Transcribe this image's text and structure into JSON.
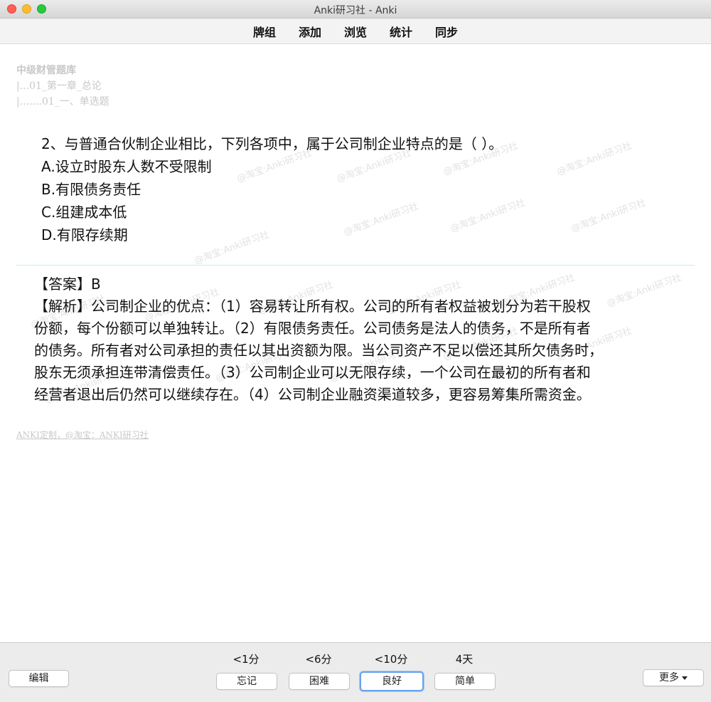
{
  "window": {
    "title": "Anki研习社 - Anki"
  },
  "toolbar": {
    "items": [
      "牌组",
      "添加",
      "浏览",
      "统计",
      "同步"
    ]
  },
  "card": {
    "breadcrumb": {
      "deck": "中级财管题库",
      "chapter": "|...01_第一章_总论",
      "section": "|.......01_一、单选题"
    },
    "question": {
      "stem": "2、与普通合伙制企业相比，下列各项中，属于公司制企业特点的是（     ）。",
      "options": [
        "A.设立时股东人数不受限制",
        "B.有限债务责任",
        "C.组建成本低",
        "D.有限存续期"
      ]
    },
    "answer": {
      "answer_line": "【答案】B",
      "explanation_lines": [
        "【解析】公司制企业的优点：（1）容易转让所有权。公司的所有者权益被划分为若干股权",
        "份额，每个份额可以单独转让。（2）有限债务责任。公司债务是法人的债务，不是所有者",
        "的债务。所有者对公司承担的责任以其出资额为限。当公司资产不足以偿还其所欠债务时，",
        "股东无须承担连带清偿责任。（3）公司制企业可以无限存续，一个公司在最初的所有者和",
        "经营者退出后仍然可以继续存在。（4）公司制企业融资渠道较多，更容易筹集所需资金。"
      ]
    },
    "watermark_text": "@淘宝:Anki研习社",
    "footer_link": "ANKI定制，@淘宝：ANKI研习社"
  },
  "bottom": {
    "edit_label": "编辑",
    "more_label": "更多",
    "answers": [
      {
        "interval": "<1分",
        "label": "忘记"
      },
      {
        "interval": "<6分",
        "label": "困难"
      },
      {
        "interval": "<10分",
        "label": "良好"
      },
      {
        "interval": "4天",
        "label": "简单"
      }
    ]
  },
  "colors": {
    "divider": "#c9ecf0",
    "focus_ring": "#6aa3ee",
    "faint_text": "#c8c8c8"
  }
}
